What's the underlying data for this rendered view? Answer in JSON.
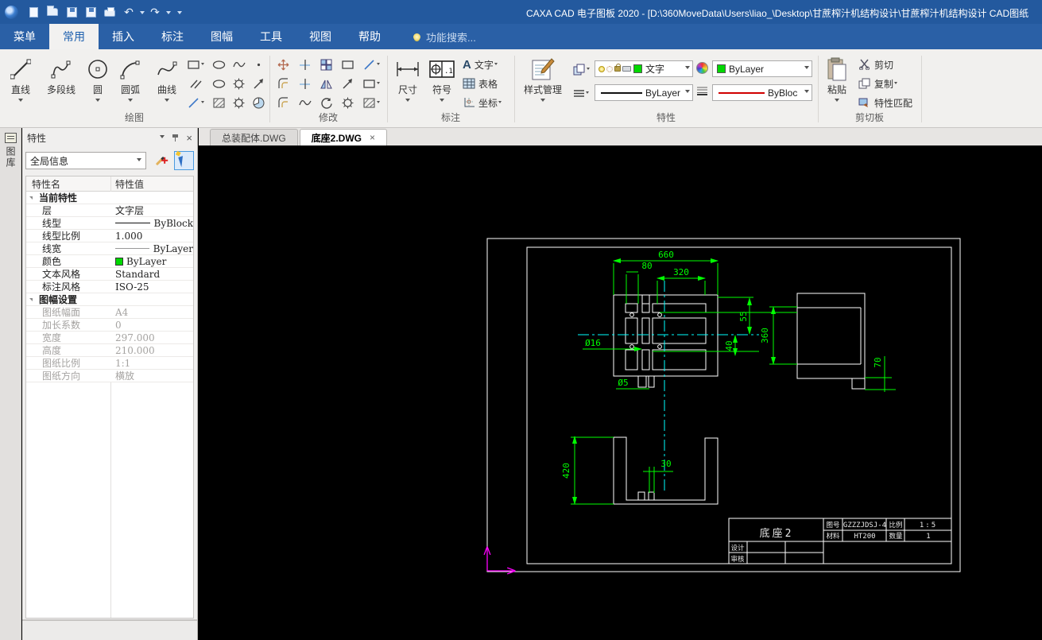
{
  "window": {
    "title": "CAXA CAD 电子图板 2020 - [D:\\360MoveData\\Users\\liao_\\Desktop\\甘蔗榨汁机结构设计\\甘蔗榨汁机结构设计 CAD图纸"
  },
  "qat": {
    "undo": "↶",
    "redo": "↷"
  },
  "menu": {
    "items": [
      "菜单",
      "常用",
      "插入",
      "标注",
      "图幅",
      "工具",
      "视图",
      "帮助"
    ],
    "active": "常用",
    "search": "功能搜索..."
  },
  "ribbon": {
    "draw": {
      "label": "绘图",
      "buttons": [
        "直线",
        "多段线",
        "圆",
        "圆弧",
        "曲线"
      ]
    },
    "modify": {
      "label": "修改"
    },
    "annotate": {
      "label": "标注",
      "dim": "尺寸",
      "symbol": "符号",
      "text": "文字",
      "table": "表格",
      "coord": "坐标",
      "a_glyph": "A",
      "dim_glyph": ".1"
    },
    "props": {
      "label": "特性",
      "style_mgr": "样式管理",
      "layer_name": "文字",
      "color_value": "ByLayer",
      "linetype_value": "ByLayer",
      "lineweight_value": "ByBloc"
    },
    "clipboard": {
      "label": "剪切板",
      "paste": "粘贴",
      "cut": "剪切",
      "copy": "复制",
      "match": "特性匹配"
    }
  },
  "sidebar": {
    "tab": "图库"
  },
  "panel": {
    "title": "特性",
    "filter": "全局信息",
    "col_name": "特性名",
    "col_value": "特性值",
    "rows": [
      {
        "label": "当前特性",
        "value": ""
      },
      {
        "label": "层",
        "value": "文字层"
      },
      {
        "label": "线型",
        "value": "ByBlock"
      },
      {
        "label": "线型比例",
        "value": "1.000"
      },
      {
        "label": "线宽",
        "value": "ByLayer"
      },
      {
        "label": "颜色",
        "value": "ByLayer"
      },
      {
        "label": "文本风格",
        "value": "Standard"
      },
      {
        "label": "标注风格",
        "value": "ISO-25"
      },
      {
        "label": "图幅设置",
        "value": ""
      },
      {
        "label": "图纸幅面",
        "value": "A4"
      },
      {
        "label": "加长系数",
        "value": "0"
      },
      {
        "label": "宽度",
        "value": "297.000"
      },
      {
        "label": "高度",
        "value": "210.000"
      },
      {
        "label": "图纸比例",
        "value": "1:1"
      },
      {
        "label": "图纸方向",
        "value": "横放"
      }
    ]
  },
  "tabs": {
    "t0": "总装配体.DWG",
    "t1": "底座2.DWG"
  },
  "drawing": {
    "dims": {
      "d660": "660",
      "d80": "80",
      "d320": "320",
      "dia16": "Ø16",
      "dia5": "Ø5",
      "d40": "40",
      "d55": "55",
      "d360": "360",
      "d70": "70",
      "d420": "420",
      "d30": "30"
    },
    "title_block": {
      "name": "底座2",
      "no_label": "图号",
      "no": "GZZZJDSJ-4",
      "scale_label": "比例",
      "scale": "1:5",
      "mat_label": "材料",
      "mat": "HT200",
      "qty_label": "数量",
      "qty": "1",
      "design": "设计",
      "check": "审核"
    }
  },
  "colors": {
    "titlebar": "#23599e",
    "ribbon_bg": "#f1f0ee",
    "dim_green": "#00ff00",
    "centerline_cyan": "#00ffff",
    "ucs_magenta": "#ff00ff",
    "layer_green": "#00d800",
    "byblock_red": "#d00000",
    "accent_blue": "#1d5fae"
  }
}
